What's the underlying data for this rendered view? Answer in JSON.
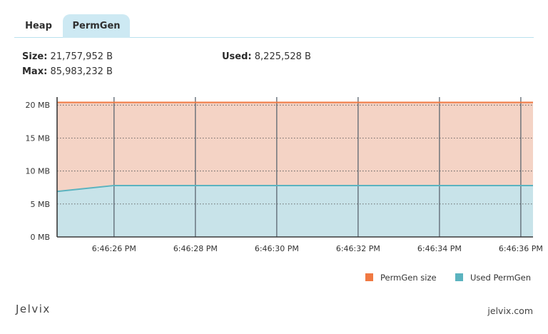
{
  "tabs": [
    {
      "label": "Heap",
      "active": false
    },
    {
      "label": "PermGen",
      "active": true
    }
  ],
  "stats": {
    "size_label": "Size:",
    "size_value": "21,757,952 B",
    "used_label": "Used:",
    "used_value": "8,225,528 B",
    "max_label": "Max:",
    "max_value": "85,983,232 B"
  },
  "chart_data": {
    "type": "area",
    "x": [
      "6:46:24.6",
      "6:46:26",
      "6:46:28",
      "6:46:30",
      "6:46:32",
      "6:46:34",
      "6:46:36",
      "6:46:36.3"
    ],
    "x_tick_labels": [
      "6:46:26 PM",
      "6:46:28 PM",
      "6:46:30 PM",
      "6:46:32 PM",
      "6:46:34 PM",
      "6:46:36 PM"
    ],
    "y_tick_labels": [
      "0 MB",
      "5 MB",
      "10 MB",
      "15 MB",
      "20 MB"
    ],
    "ylim": [
      0,
      21
    ],
    "series": [
      {
        "name": "PermGen size",
        "color": "#f07942",
        "fill": "#f4d3c5",
        "values": [
          20.4,
          20.4,
          20.4,
          20.4,
          20.4,
          20.4,
          20.4,
          20.4
        ]
      },
      {
        "name": "Used PermGen",
        "color": "#5bb3bf",
        "fill": "#c8e3e9",
        "values": [
          6.9,
          7.8,
          7.8,
          7.8,
          7.8,
          7.8,
          7.8,
          7.8
        ]
      }
    ],
    "grid": true,
    "legend_position": "bottom-right"
  },
  "footer": {
    "brand": "Jelvix",
    "site": "jelvix.com"
  }
}
